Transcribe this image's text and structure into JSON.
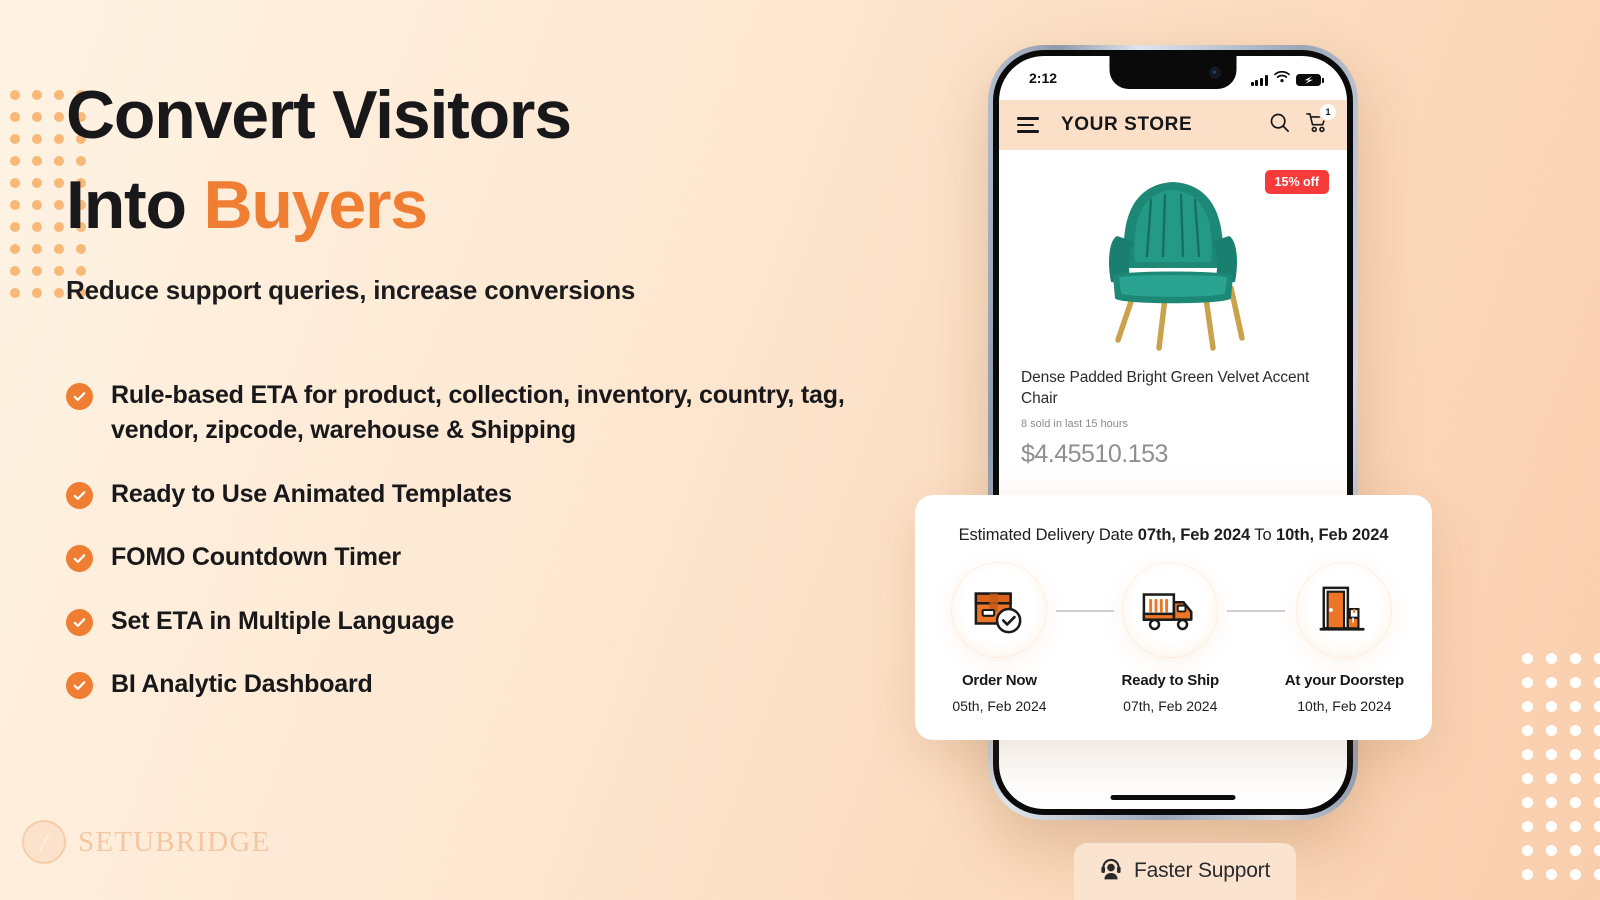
{
  "headline": {
    "line1": "Convert Visitors",
    "line2_plain": "Into ",
    "line2_accent": "Buyers"
  },
  "subheadline": "Reduce support queries, increase conversions",
  "features": [
    "Rule-based ETA for product, collection, inventory, country, tag, vendor, zipcode, warehouse & Shipping",
    "Ready to Use Animated Templates",
    "FOMO Countdown Timer",
    "Set ETA in Multiple Language",
    "BI Analytic Dashboard"
  ],
  "logo": {
    "name": "SETUBRIDGE"
  },
  "phone": {
    "statusbar": {
      "time": "2:12"
    },
    "storebar": {
      "store_name": "YOUR STORE",
      "cart_count": "1"
    },
    "product": {
      "offer_badge": "15% off",
      "title": "Dense Padded Bright Green Velvet Accent Chair",
      "sold_note": "8 sold in last 15 hours",
      "price": "$4.45510.153"
    }
  },
  "eta_card": {
    "title_prefix": "Estimated Delivery Date ",
    "from_date": "07th, Feb 2024",
    "title_middle": " To ",
    "to_date": "10th, Feb 2024",
    "steps": [
      {
        "label": "Order Now",
        "date": "05th, Feb 2024",
        "icon": "package-check-icon"
      },
      {
        "label": "Ready to Ship",
        "date": "07th, Feb 2024",
        "icon": "delivery-truck-icon"
      },
      {
        "label": "At your Doorstep",
        "date": "10th, Feb 2024",
        "icon": "door-delivery-icon"
      }
    ]
  },
  "support_pill": {
    "label": "Faster Support",
    "icon": "support-agent-icon"
  },
  "colors": {
    "accent_orange": "#F07E32",
    "badge_red": "#F73B3B",
    "heading_dark": "#18181B",
    "bg_start": "#FEF3E4",
    "bg_end": "#F9CEAD",
    "store_bar": "#FBDFC6",
    "chair_green": "#1E8877"
  }
}
